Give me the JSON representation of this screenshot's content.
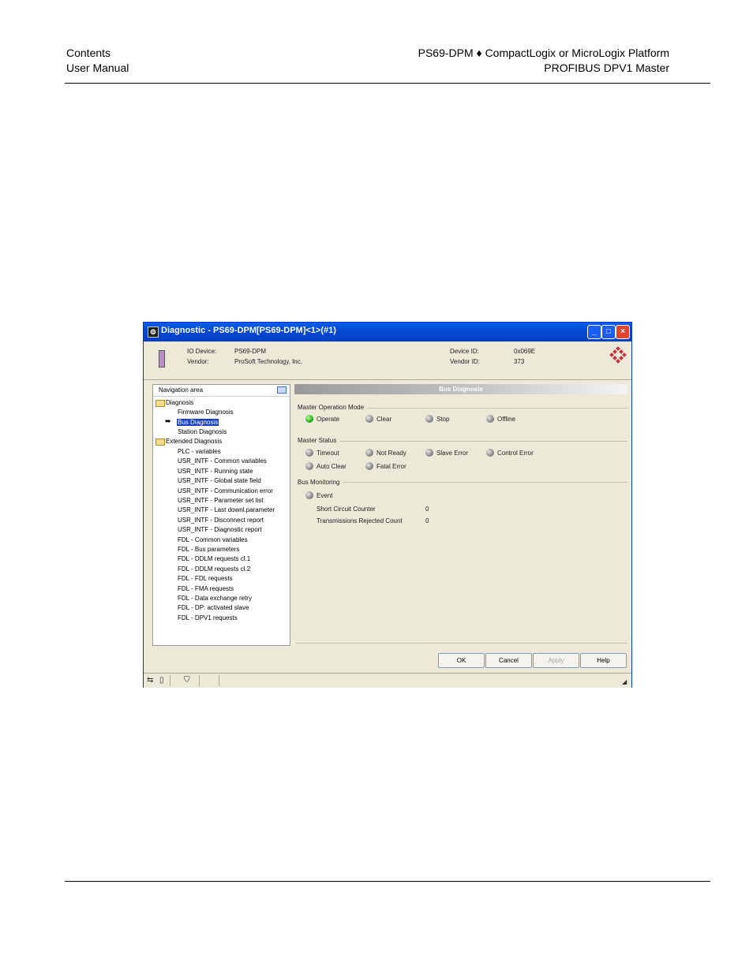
{
  "page_header": {
    "left_line1": "Contents",
    "left_line2": "User Manual",
    "right_line1": "PS69-DPM ♦ CompactLogix or MicroLogix Platform",
    "right_line2": "PROFIBUS DPV1 Master"
  },
  "window": {
    "title": "Diagnostic - PS69-DPM[PS69-DPM]<1>(#1)",
    "minimize": "_",
    "maximize": "□",
    "close": "×"
  },
  "device_info": {
    "io_device_label": "IO Device:",
    "io_device_value": "PS69-DPM",
    "vendor_label": "Vendor:",
    "vendor_value": "ProSoft Technology, Inc.",
    "device_id_label": "Device ID:",
    "device_id_value": "0x069E",
    "vendor_id_label": "Vendor ID:",
    "vendor_id_value": "373"
  },
  "navigation": {
    "header": "Navigation area",
    "diagnosis": "Diagnosis",
    "firmware": "Firmware Diagnosis",
    "bus": "Bus Diagnosis",
    "station": "Station Diagnosis",
    "extended": "Extended Diagnosis",
    "extended_items": [
      "PLC - variables",
      "USR_INTF - Common variables",
      "USR_INTF - Running state",
      "USR_INTF - Global state field",
      "USR_INTF - Communication error",
      "USR_INTF - Parameter set list",
      "USR_INTF - Last downl.parameter",
      "USR_INTF - Disconnect report",
      "USR_INTF - Diagnostic report",
      "FDL - Common variables",
      "FDL - Bus parameters",
      "FDL - DDLM requests cl.1",
      "FDL - DDLM requests cl.2",
      "FDL - FDL requests",
      "FDL - FMA requests",
      "FDL - Data exchange retry",
      "FDL - DP: activated slave",
      "FDL - DPV1 requests"
    ]
  },
  "bus_diagnosis": {
    "title": "Bus Diagnosis",
    "mode_group": "Master Operation Mode",
    "mode": {
      "operate": "Operate",
      "clear": "Clear",
      "stop": "Stop",
      "offline": "Offline"
    },
    "status_group": "Master Status",
    "status": {
      "timeout": "Timeout",
      "not_ready": "Not Ready",
      "slave_error": "Slave Error",
      "control_error": "Control Error",
      "auto_clear": "Auto Clear",
      "fatal_error": "Fatal Error"
    },
    "monitoring_group": "Bus Monitoring",
    "event": "Event",
    "short_circuit_label": "Short Circuit Counter",
    "short_circuit_value": "0",
    "rejected_label": "Transmissions Rejected Count",
    "rejected_value": "0"
  },
  "buttons": {
    "ok": "OK",
    "cancel": "Cancel",
    "apply": "Apply",
    "help": "Help"
  },
  "colors": {
    "title_bar": "#0549d4",
    "led_on": "#22b21a",
    "led_off": "#8a8a8a",
    "selection": "#1a3fbd"
  }
}
